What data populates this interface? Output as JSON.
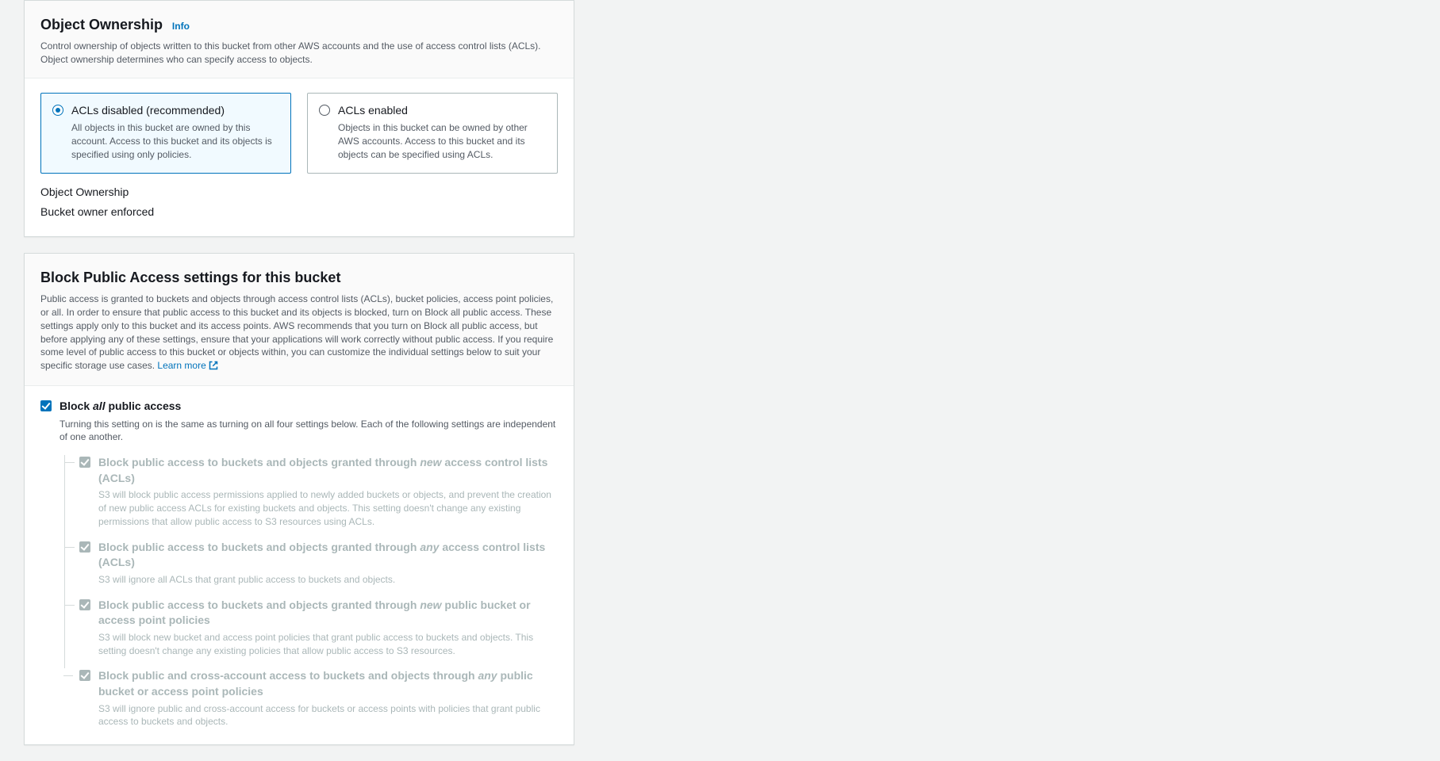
{
  "ownership": {
    "title": "Object Ownership",
    "info": "Info",
    "description": "Control ownership of objects written to this bucket from other AWS accounts and the use of access control lists (ACLs). Object ownership determines who can specify access to objects.",
    "tile1": {
      "title": "ACLs disabled (recommended)",
      "desc": "All objects in this bucket are owned by this account. Access to this bucket and its objects is specified using only policies."
    },
    "tile2": {
      "title": "ACLs enabled",
      "desc": "Objects in this bucket can be owned by other AWS accounts. Access to this bucket and its objects can be specified using ACLs."
    },
    "kv_label": "Object Ownership",
    "kv_value": "Bucket owner enforced"
  },
  "block": {
    "title": "Block Public Access settings for this bucket",
    "description": "Public access is granted to buckets and objects through access control lists (ACLs), bucket policies, access point policies, or all. In order to ensure that public access to this bucket and its objects is blocked, turn on Block all public access. These settings apply only to this bucket and its access points. AWS recommends that you turn on Block all public access, but before applying any of these settings, ensure that your applications will work correctly without public access. If you require some level of public access to this bucket or objects within, you can customize the individual settings below to suit your specific storage use cases. ",
    "learn_more": "Learn more",
    "all_label_pre": "Block ",
    "all_label_em": "all",
    "all_label_post": " public access",
    "all_desc": "Turning this setting on is the same as turning on all four settings below. Each of the following settings are independent of one another.",
    "sub": [
      {
        "pre": "Block public access to buckets and objects granted through ",
        "em": "new",
        "post": " access control lists (ACLs)",
        "desc": "S3 will block public access permissions applied to newly added buckets or objects, and prevent the creation of new public access ACLs for existing buckets and objects. This setting doesn't change any existing permissions that allow public access to S3 resources using ACLs."
      },
      {
        "pre": "Block public access to buckets and objects granted through ",
        "em": "any",
        "post": " access control lists (ACLs)",
        "desc": "S3 will ignore all ACLs that grant public access to buckets and objects."
      },
      {
        "pre": "Block public access to buckets and objects granted through ",
        "em": "new",
        "post": " public bucket or access point policies",
        "desc": "S3 will block new bucket and access point policies that grant public access to buckets and objects. This setting doesn't change any existing policies that allow public access to S3 resources."
      },
      {
        "pre": "Block public and cross-account access to buckets and objects through ",
        "em": "any",
        "post": " public bucket or access point policies",
        "desc": "S3 will ignore public and cross-account access for buckets or access points with policies that grant public access to buckets and objects."
      }
    ]
  }
}
